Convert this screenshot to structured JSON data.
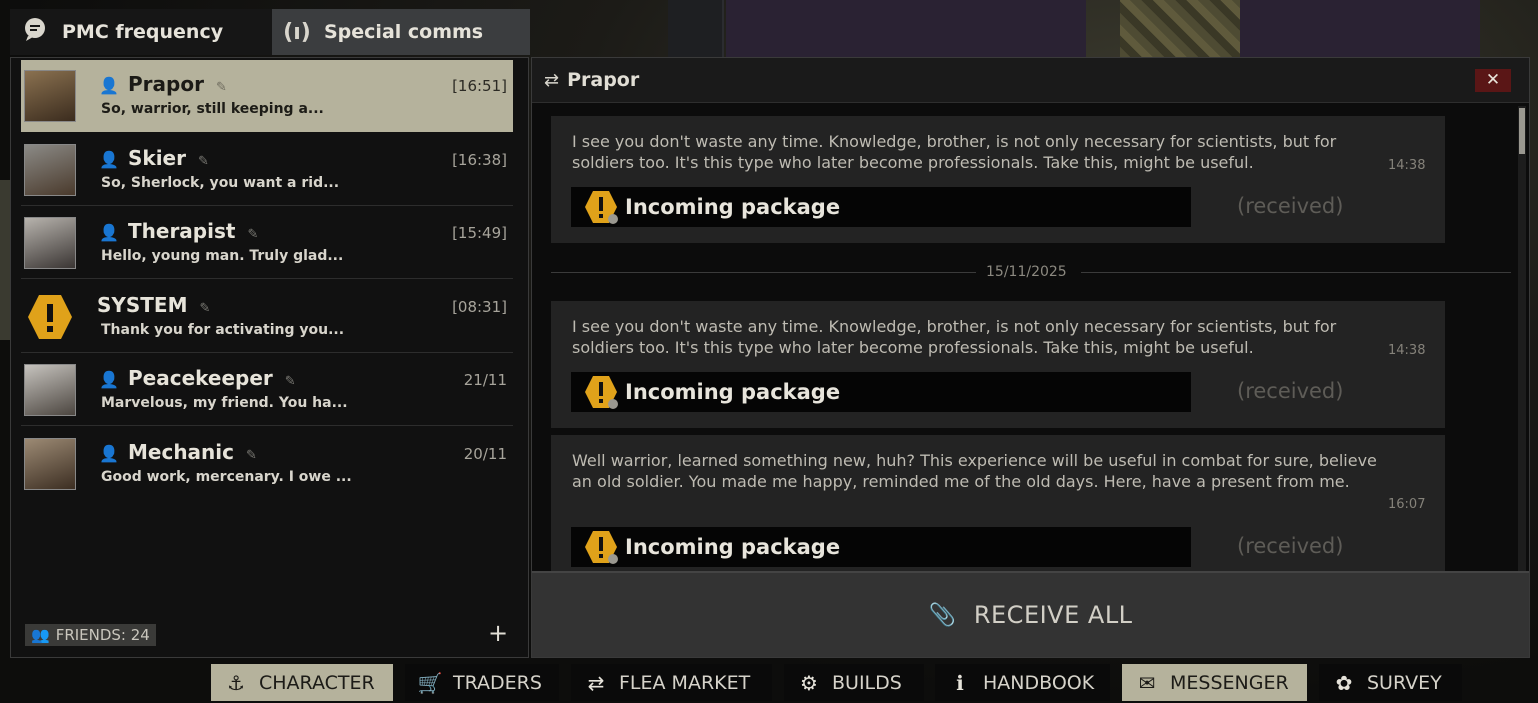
{
  "tabs": [
    {
      "label": "PMC frequency",
      "icon": "chat-bubble-icon"
    },
    {
      "label": "Special comms",
      "icon": "antenna-icon"
    }
  ],
  "dialogs": [
    {
      "name": "Prapor",
      "time": "[16:51]",
      "preview": "So, warrior, still keeping a..."
    },
    {
      "name": "Skier",
      "time": "[16:38]",
      "preview": "So, Sherlock, you want a rid..."
    },
    {
      "name": "Therapist",
      "time": "[15:49]",
      "preview": "Hello, young man. Truly glad..."
    },
    {
      "name": "SYSTEM",
      "time": "[08:31]",
      "preview": "Thank you for activating you..."
    },
    {
      "name": "Peacekeeper",
      "time": "21/11",
      "preview": "Marvelous, my friend. You ha..."
    },
    {
      "name": "Mechanic",
      "time": "20/11",
      "preview": "Good work, mercenary. I owe ..."
    }
  ],
  "friends_label": "FRIENDS: 24",
  "add_symbol": "+",
  "chat": {
    "title": "Prapor",
    "close_symbol": "✕",
    "date_separator": "15/11/2025",
    "messages": [
      {
        "text": "I see you don't waste any time. Knowledge, brother, is not only necessary for scientists, but for soldiers too. It's this type who later become professionals. Take this, might be useful.",
        "time": "14:38",
        "package": "Incoming package",
        "status": "(received)"
      },
      {
        "text": "I see you don't waste any time. Knowledge, brother, is not only necessary for scientists, but for soldiers too. It's this type who later become professionals. Take this, might be useful.",
        "time": "14:38",
        "package": "Incoming package",
        "status": "(received)"
      },
      {
        "text": "Well warrior, learned something new, huh? This experience will be useful in combat for sure, believe an old soldier. You made me happy, reminded me of the old days. Here, have a present from me.",
        "time": "16:07",
        "package": "Incoming package",
        "status": "(received)"
      }
    ],
    "receive_all": "RECEIVE ALL"
  },
  "nav": [
    {
      "label": "CHARACTER",
      "icon": "character-icon",
      "active": true
    },
    {
      "label": "TRADERS",
      "icon": "cart-icon",
      "active": false
    },
    {
      "label": "FLEA MARKET",
      "icon": "exchange-icon",
      "active": false
    },
    {
      "label": "BUILDS",
      "icon": "builds-icon",
      "active": false
    },
    {
      "label": "HANDBOOK",
      "icon": "handbook-icon",
      "active": false
    },
    {
      "label": "MESSENGER",
      "icon": "messenger-icon",
      "active": true
    },
    {
      "label": "SURVEY",
      "icon": "survey-icon",
      "active": false
    }
  ],
  "colors": {
    "active_highlight": "#b5b29c",
    "warning_yellow": "#e0a21a",
    "close_red": "#5a1616"
  }
}
